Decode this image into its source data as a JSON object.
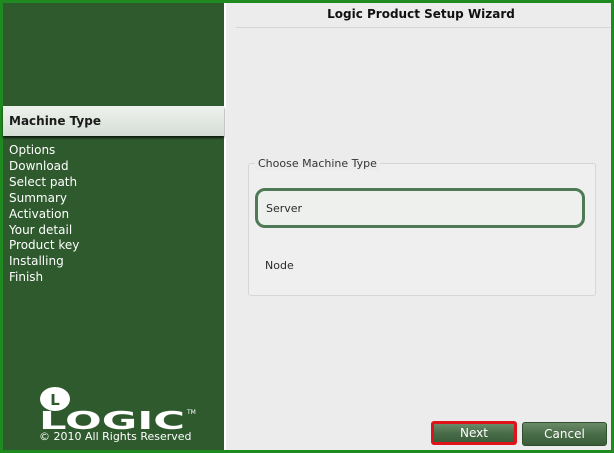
{
  "window": {
    "title": "Logic Product Setup Wizard"
  },
  "sidebar": {
    "active_step": "Machine Type",
    "steps": [
      "Options",
      "Download",
      "Select path",
      "Summary",
      "Activation",
      "Your detail",
      "Product key",
      "Installing",
      "Finish"
    ],
    "logo_text": "LOGIC",
    "logo_mark": "L",
    "trademark": "TM",
    "copyright": "© 2010 All Rights Reserved"
  },
  "main": {
    "group_label": "Choose Machine Type",
    "options": [
      {
        "label": "Server",
        "selected": true
      },
      {
        "label": "Node",
        "selected": false
      }
    ]
  },
  "buttons": {
    "next_label": "Next",
    "cancel_label": "Cancel"
  },
  "colors": {
    "sidebar_bg": "#2e5a2e",
    "window_border": "#1f8a1f",
    "button_bg": "#4a6d49",
    "selected_border": "#4e7a55",
    "highlight": "#e0121a"
  }
}
